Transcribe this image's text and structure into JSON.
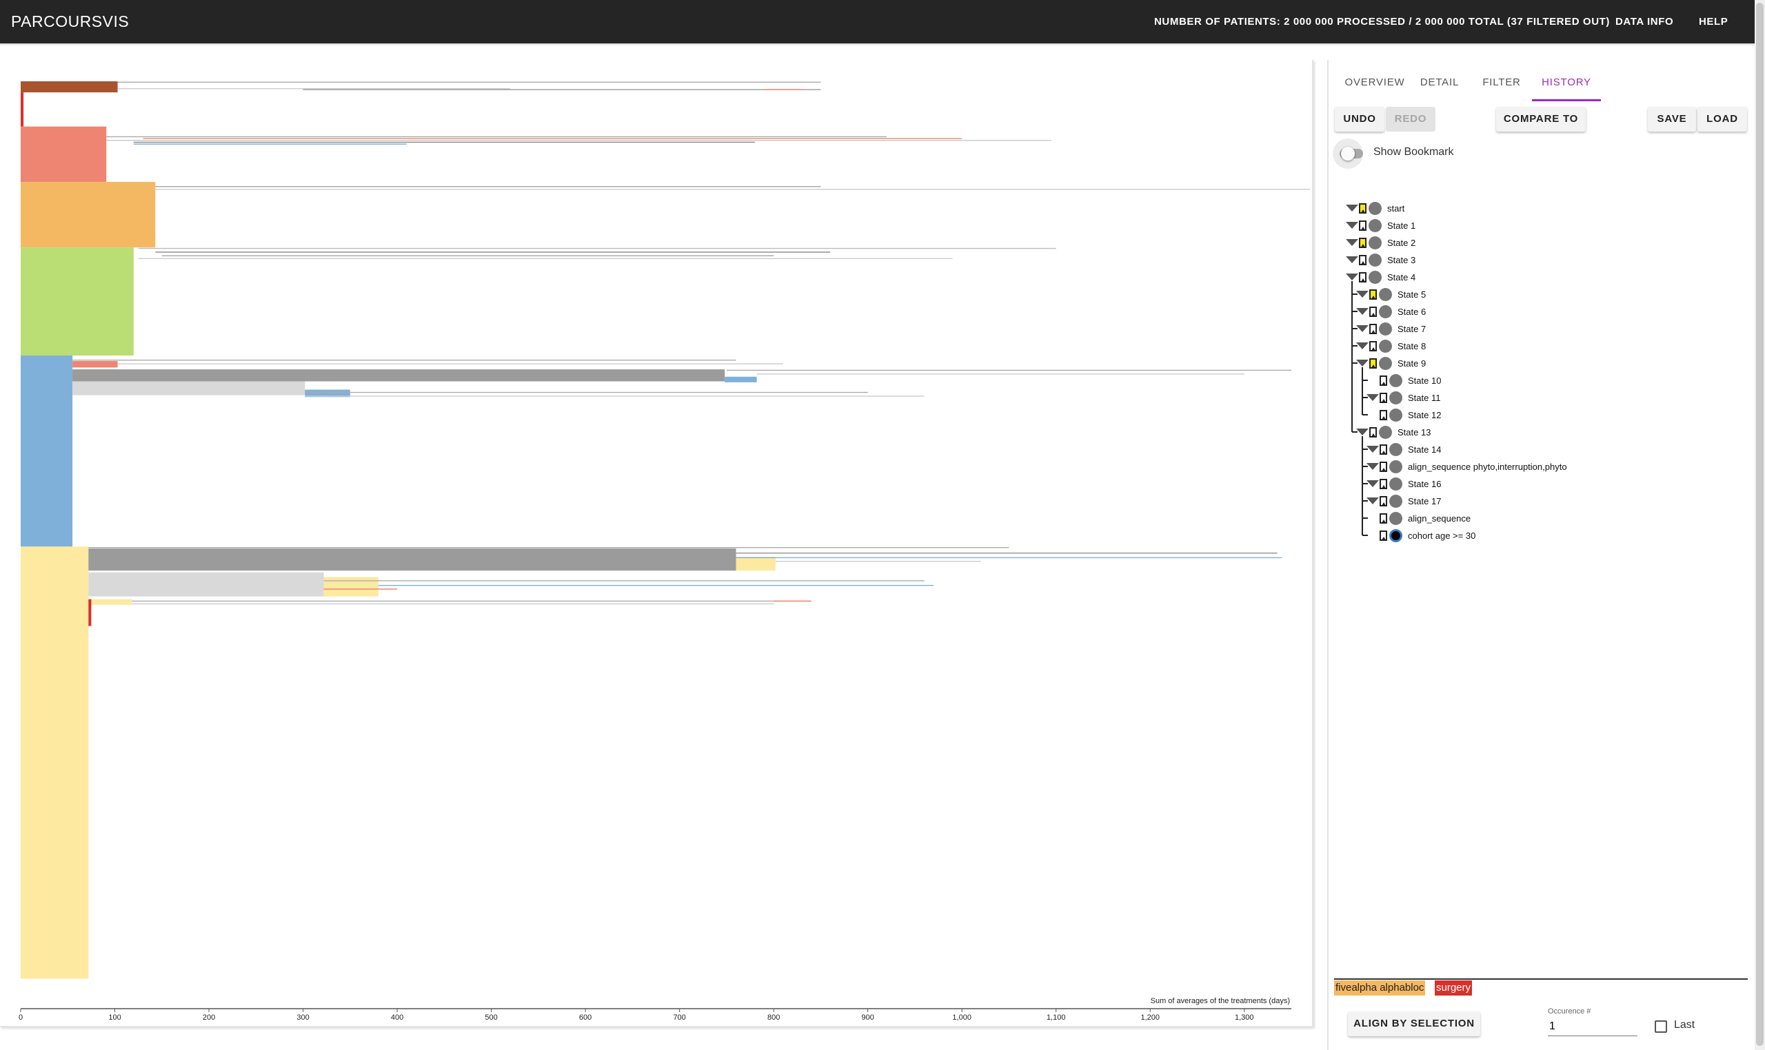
{
  "app": {
    "title": "PARCOURSVIS"
  },
  "header": {
    "patients_text": "NUMBER OF PATIENTS: 2 000 000 PROCESSED / 2 000 000 TOTAL (37 FILTERED OUT)",
    "data_info": "DATA INFO",
    "help": "HELP"
  },
  "tabs": [
    {
      "label": "OVERVIEW",
      "active": false
    },
    {
      "label": "DETAIL",
      "active": false
    },
    {
      "label": "FILTER",
      "active": false
    },
    {
      "label": "HISTORY",
      "active": true
    }
  ],
  "toolbar": {
    "undo": "UNDO",
    "redo": "REDO",
    "compare": "COMPARE TO",
    "save": "SAVE",
    "load": "LOAD"
  },
  "bookmark_toggle": {
    "label": "Show Bookmark",
    "checked": false
  },
  "history": [
    {
      "label": "start",
      "depth": 0,
      "bookmarked": true,
      "expandable": true
    },
    {
      "label": "State 1",
      "depth": 0,
      "bookmarked": false,
      "expandable": true
    },
    {
      "label": "State 2",
      "depth": 0,
      "bookmarked": true,
      "expandable": true
    },
    {
      "label": "State 3",
      "depth": 0,
      "bookmarked": false,
      "expandable": true
    },
    {
      "label": "State 4",
      "depth": 0,
      "bookmarked": false,
      "expandable": true
    },
    {
      "label": "State 5",
      "depth": 1,
      "bookmarked": true,
      "expandable": true
    },
    {
      "label": "State 6",
      "depth": 1,
      "bookmarked": false,
      "expandable": true
    },
    {
      "label": "State 7",
      "depth": 1,
      "bookmarked": false,
      "expandable": true
    },
    {
      "label": "State 8",
      "depth": 1,
      "bookmarked": false,
      "expandable": true
    },
    {
      "label": "State 9",
      "depth": 1,
      "bookmarked": true,
      "expandable": true
    },
    {
      "label": "State 10",
      "depth": 2,
      "bookmarked": false,
      "expandable": false
    },
    {
      "label": "State 11",
      "depth": 2,
      "bookmarked": false,
      "expandable": true
    },
    {
      "label": "State 12",
      "depth": 2,
      "bookmarked": false,
      "expandable": false
    },
    {
      "label": "State 13",
      "depth": 1,
      "bookmarked": false,
      "expandable": true
    },
    {
      "label": "State 14",
      "depth": 2,
      "bookmarked": false,
      "expandable": true
    },
    {
      "label": "align_sequence phyto,interruption,phyto",
      "depth": 2,
      "bookmarked": false,
      "expandable": true
    },
    {
      "label": "State 16",
      "depth": 2,
      "bookmarked": false,
      "expandable": true
    },
    {
      "label": "State 17",
      "depth": 2,
      "bookmarked": false,
      "expandable": true
    },
    {
      "label": "align_sequence",
      "depth": 2,
      "bookmarked": false,
      "expandable": false
    },
    {
      "label": "cohort age >= 30",
      "depth": 2,
      "bookmarked": false,
      "expandable": false,
      "current": true
    }
  ],
  "selection": {
    "chips": [
      {
        "label": "fivealpha alphabloc",
        "color": "#f5b862",
        "text_color": "#222222"
      },
      {
        "label": "surgery",
        "color": "#d7312b",
        "text_color": "#ffffff"
      }
    ],
    "align_button": "ALIGN BY SELECTION",
    "occurrence_label": "Occurence #",
    "occurrence_value": "1",
    "last_label": "Last",
    "last_checked": false
  },
  "viz": {
    "axis_title": "Sum of averages of the treatments (days)",
    "x_domain": [
      0,
      1350
    ],
    "ticks": [
      "0",
      "100",
      "200",
      "300",
      "400",
      "500",
      "600",
      "700",
      "800",
      "900",
      "1,000",
      "1,100",
      "1,200",
      "1,300"
    ],
    "colors": {
      "surgery": "#d7312b",
      "brown": "#a8552e",
      "salmon": "#ee8572",
      "fivealpha_alphabloc": "#f5b862",
      "green": "#bade73",
      "blue": "#7fb0d9",
      "yellow": "#fee9a0",
      "gray_dark": "#9b9b9b",
      "gray_light": "#d9d9d9"
    },
    "blocks": [
      {
        "category": "brown",
        "start": 0,
        "end": 103,
        "rows": [
          0.0,
          0.012
        ]
      },
      {
        "category": "surgery",
        "start": 0,
        "end": 3,
        "rows": [
          0.012,
          0.049
        ]
      },
      {
        "category": "salmon",
        "start": 0,
        "end": 91,
        "rows": [
          0.049,
          0.109
        ]
      },
      {
        "category": "fivealpha_alphabloc",
        "start": 0,
        "end": 143,
        "rows": [
          0.109,
          0.18
        ]
      },
      {
        "category": "green",
        "start": 0,
        "end": 120,
        "rows": [
          0.18,
          0.297
        ]
      },
      {
        "category": "blue",
        "start": 0,
        "end": 55,
        "rows": [
          0.297,
          0.504
        ]
      },
      {
        "category": "yellow",
        "start": 0,
        "end": 72,
        "rows": [
          0.504,
          0.972
        ]
      },
      {
        "category": "gray_dark",
        "start": 55,
        "end": 748,
        "rows": [
          0.312,
          0.325
        ]
      },
      {
        "category": "gray_light",
        "start": 55,
        "end": 302,
        "rows": [
          0.325,
          0.34
        ]
      },
      {
        "category": "salmon",
        "start": 55,
        "end": 103,
        "rows": [
          0.303,
          0.31
        ]
      },
      {
        "category": "blue",
        "start": 302,
        "end": 350,
        "rows": [
          0.334,
          0.342
        ]
      },
      {
        "category": "blue",
        "start": 748,
        "end": 782,
        "rows": [
          0.32,
          0.326
        ]
      },
      {
        "category": "gray_dark",
        "start": 72,
        "end": 760,
        "rows": [
          0.506,
          0.53
        ]
      },
      {
        "category": "gray_light",
        "start": 72,
        "end": 322,
        "rows": [
          0.532,
          0.558
        ]
      },
      {
        "category": "yellow",
        "start": 322,
        "end": 380,
        "rows": [
          0.537,
          0.558
        ]
      },
      {
        "category": "yellow",
        "start": 760,
        "end": 802,
        "rows": [
          0.515,
          0.53
        ]
      },
      {
        "category": "yellow",
        "start": 72,
        "end": 118,
        "rows": [
          0.561,
          0.567
        ]
      },
      {
        "category": "surgery",
        "start": 72,
        "end": 75,
        "rows": [
          0.561,
          0.59
        ]
      }
    ]
  }
}
